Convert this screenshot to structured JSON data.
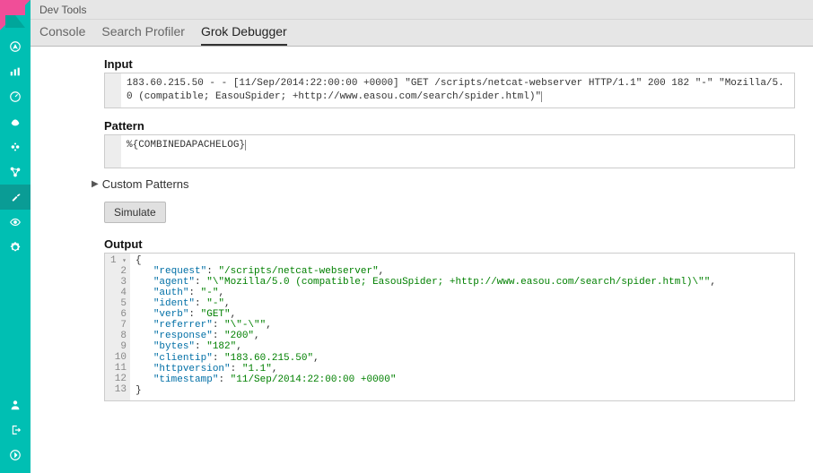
{
  "titlebar": "Dev Tools",
  "tabs": {
    "console": "Console",
    "profiler": "Search Profiler",
    "grok": "Grok Debugger"
  },
  "labels": {
    "input": "Input",
    "pattern": "Pattern",
    "custom": "Custom Patterns",
    "output": "Output",
    "simulate": "Simulate"
  },
  "input_value": "183.60.215.50 - - [11/Sep/2014:22:00:00 +0000] \"GET /scripts/netcat-webserver HTTP/1.1\" 200 182 \"-\" \"Mozilla/5.0 (compatible; EasouSpider; +http://www.easou.com/search/spider.html)\"",
  "pattern_value": "%{COMBINEDAPACHELOG}",
  "output_json": {
    "request": "/scripts/netcat-webserver",
    "agent": "\\\"Mozilla/5.0 (compatible; EasouSpider; +http://www.easou.com/search/spider.html)\\\"",
    "auth": "-",
    "ident": "-",
    "verb": "GET",
    "referrer": "\\\"-\\\"",
    "response": "200",
    "bytes": "182",
    "clientip": "183.60.215.50",
    "httpversion": "1.1",
    "timestamp": "11/Sep/2014:22:00:00 +0000"
  },
  "output_keys_order": [
    "request",
    "agent",
    "auth",
    "ident",
    "verb",
    "referrer",
    "response",
    "bytes",
    "clientip",
    "httpversion",
    "timestamp"
  ],
  "sidebar_icons": {
    "discover": "compass-icon",
    "visualize": "bar-chart-icon",
    "dashboard": "dashboard-icon",
    "timelion": "timelion-icon",
    "ml": "ml-icon",
    "graph": "graph-icon",
    "devtools": "wrench-icon",
    "monitoring": "eye-icon",
    "management": "gear-icon",
    "account": "user-icon",
    "logout": "logout-icon",
    "collapse": "collapse-icon"
  }
}
